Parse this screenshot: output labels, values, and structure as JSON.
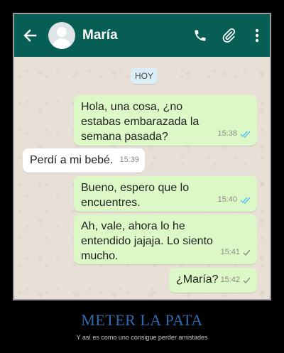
{
  "header": {
    "contact_name": "María",
    "icons": [
      "back-arrow-icon",
      "avatar-icon",
      "phone-icon",
      "paperclip-icon",
      "more-vert-icon"
    ],
    "bar_color": "#075e54"
  },
  "date_separator": "HOY",
  "messages": [
    {
      "side": "out",
      "text": "Hola, una cosa, ¿no\nestabas embarazada la\nsemana pasada?",
      "time": "15:38",
      "status": "read"
    },
    {
      "side": "in",
      "text": "Perdí a mi bebé.",
      "time": "15:39"
    },
    {
      "side": "out",
      "text": "Bueno, espero que lo\nencuentres.",
      "time": "15:40",
      "status": "read"
    },
    {
      "side": "out",
      "text": "Ah, vale, ahora lo he\nentendido jajaja. Lo siento\nmucho.",
      "time": "15:41",
      "status": "delivered"
    },
    {
      "side": "out",
      "text": "¿María?",
      "time": "15:42",
      "status": "delivered"
    }
  ],
  "caption": {
    "title": "METER LA PATA",
    "subtitle": "Y así es como uno consigue perder amistades"
  },
  "colors": {
    "outgoing_bubble": "#dcf8c6",
    "incoming_bubble": "#ffffff",
    "read_tick": "#4fc3f7",
    "delivered_tick": "#8a8a8a",
    "caption_title": "#2d6bb0"
  }
}
